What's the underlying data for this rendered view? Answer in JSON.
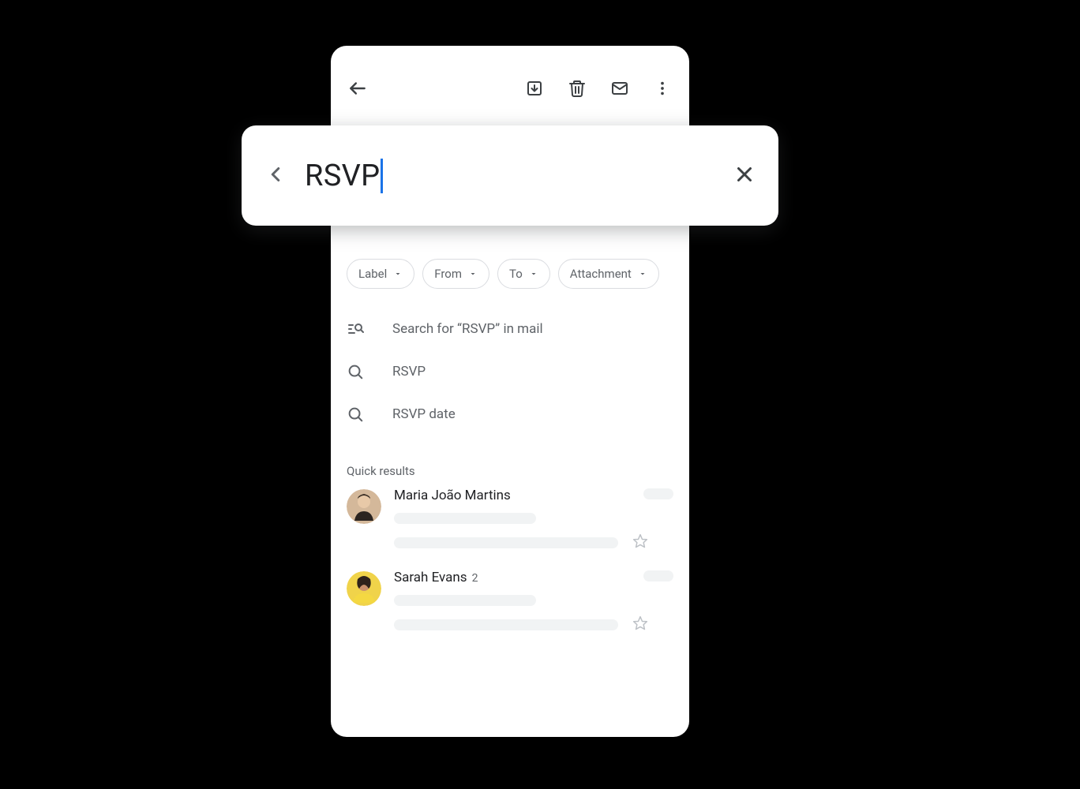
{
  "search": {
    "query": "RSVP"
  },
  "filters": [
    {
      "label": "Label"
    },
    {
      "label": "From"
    },
    {
      "label": "To"
    },
    {
      "label": "Attachment"
    }
  ],
  "suggestions": {
    "searchInMail": "Search for “RSVP” in mail",
    "items": [
      {
        "text": "RSVP"
      },
      {
        "text": "RSVP date"
      }
    ]
  },
  "quickResults": {
    "heading": "Quick results",
    "items": [
      {
        "name": "Maria João Martins",
        "count": ""
      },
      {
        "name": "Sarah Evans",
        "count": "2"
      }
    ]
  }
}
